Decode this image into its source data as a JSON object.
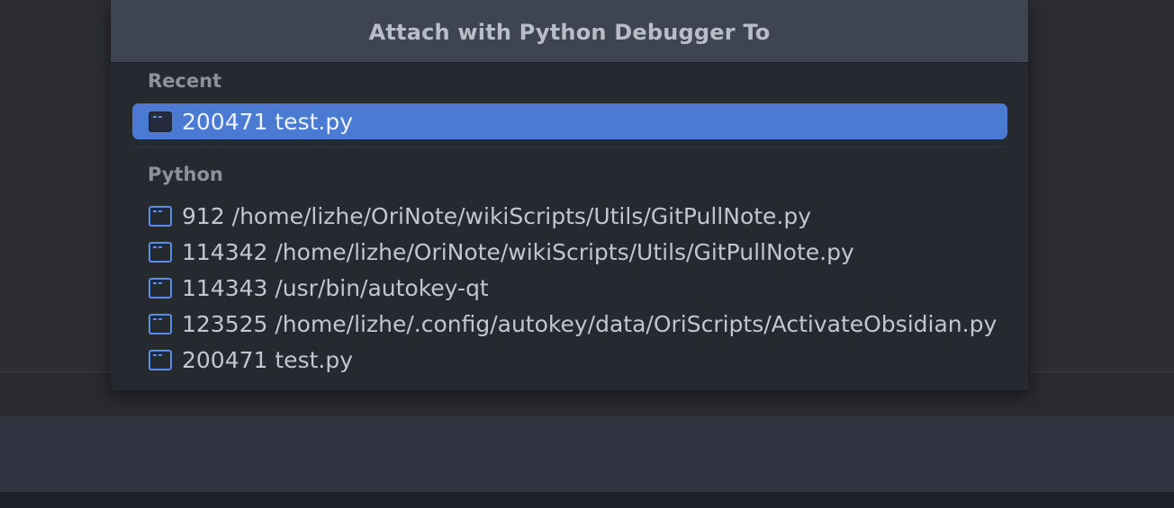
{
  "dialog": {
    "title": "Attach with Python Debugger To"
  },
  "recent": {
    "label": "Recent",
    "items": [
      {
        "text": "200471 test.py",
        "icon": "process-icon",
        "selected": true
      }
    ]
  },
  "python": {
    "label": "Python",
    "items": [
      {
        "text": "912 /home/lizhe/OriNote/wikiScripts/Utils/GitPullNote.py",
        "icon": "process-icon"
      },
      {
        "text": "114342 /home/lizhe/OriNote/wikiScripts/Utils/GitPullNote.py",
        "icon": "process-icon"
      },
      {
        "text": "114343 /usr/bin/autokey-qt",
        "icon": "process-icon"
      },
      {
        "text": "123525 /home/lizhe/.config/autokey/data/OriScripts/ActivateObsidian.py",
        "icon": "process-icon"
      },
      {
        "text": "200471 test.py",
        "icon": "process-icon"
      }
    ]
  },
  "colors": {
    "accent": "#4a7ad1",
    "icon": "#5a8ce8",
    "header": "#3f4451",
    "popup_bg": "#262930"
  }
}
